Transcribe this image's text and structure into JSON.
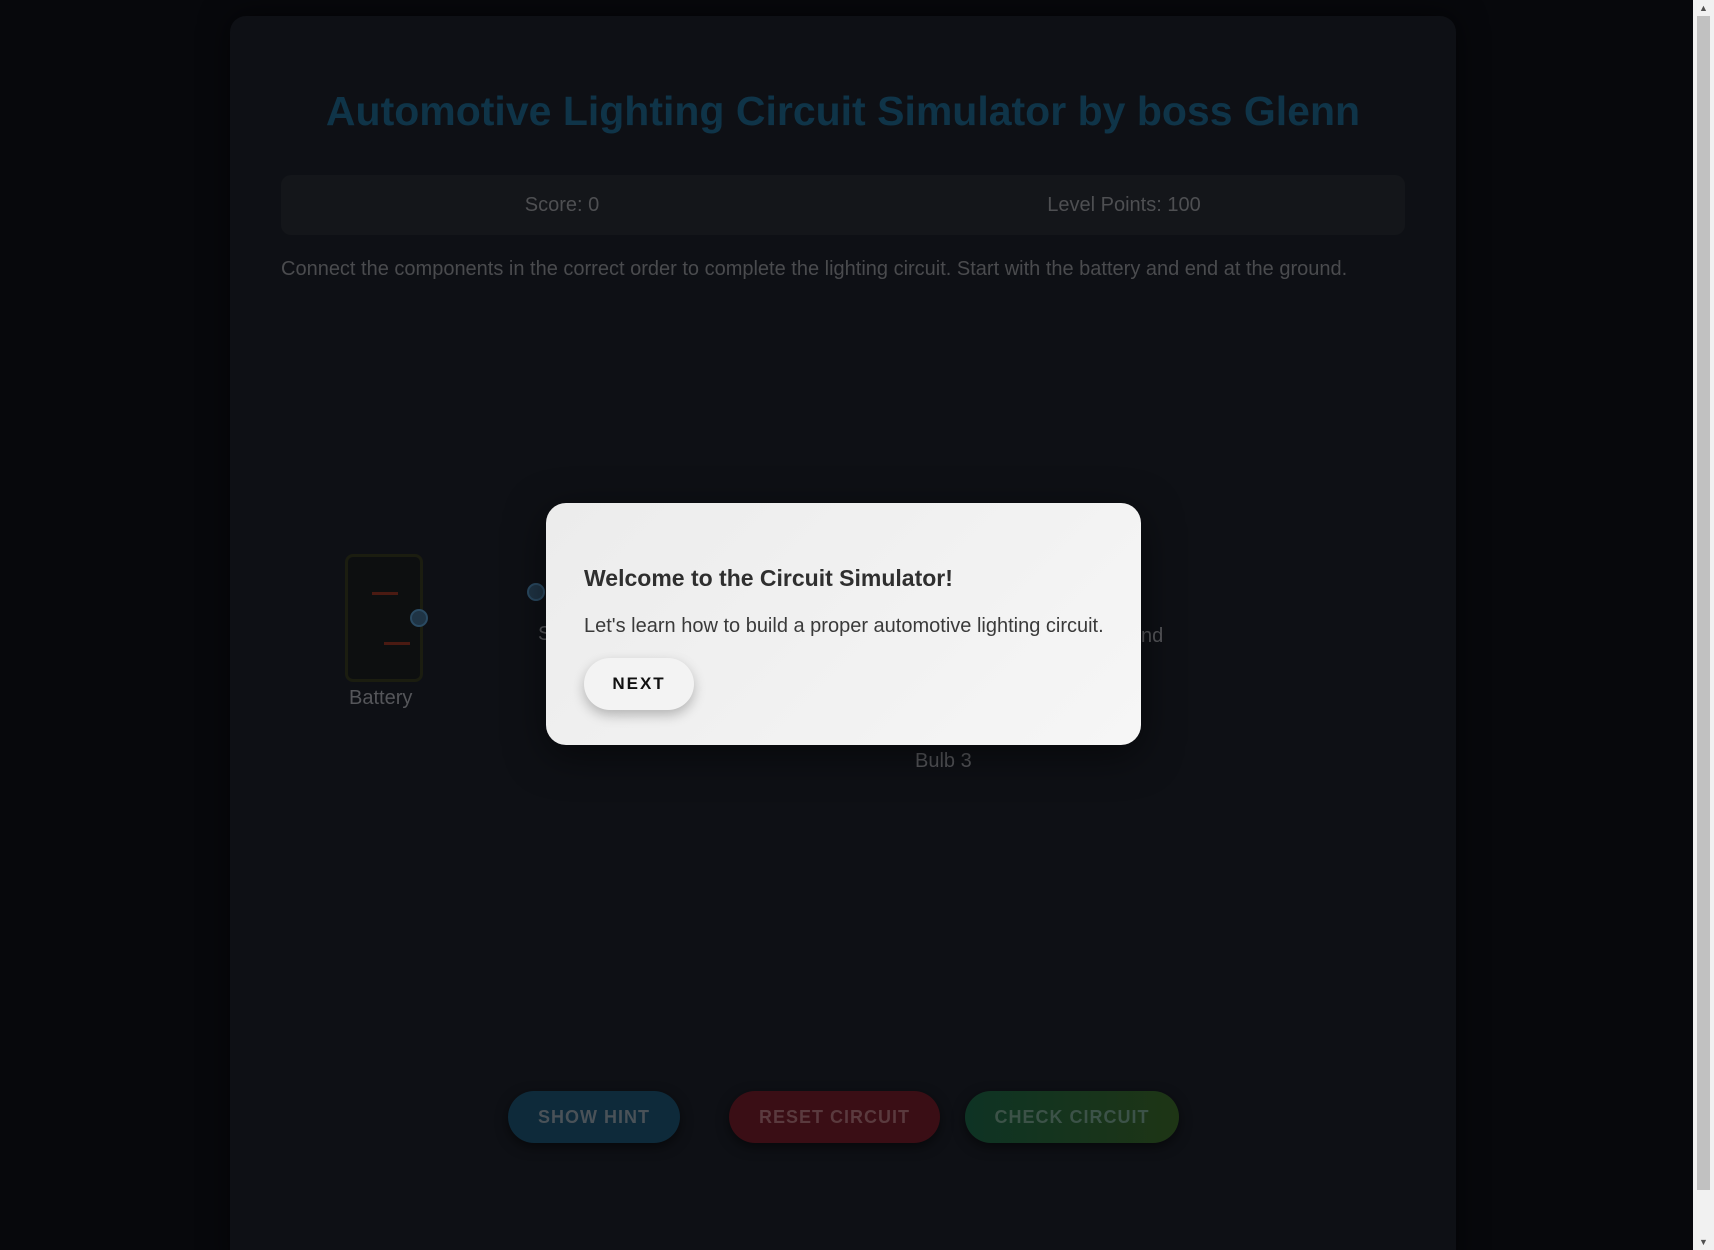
{
  "app": {
    "title": "Automotive Lighting Circuit Simulator by boss Glenn",
    "score_label": "Score: 0",
    "level_points_label": "Level Points: 100",
    "instructions": "Connect the components in the correct order to complete the lighting circuit. Start with the battery and end at the ground."
  },
  "components": {
    "battery_label": "Battery",
    "bulb3_label": "Bulb 3",
    "ground_label_partial": "nd",
    "switch_label_partial": "S"
  },
  "buttons": {
    "hint": "SHOW HINT",
    "reset": "RESET CIRCUIT",
    "check": "CHECK CIRCUIT"
  },
  "modal": {
    "title": "Welcome to the Circuit Simulator!",
    "text": "Let's learn how to build a proper automotive lighting circuit.",
    "next_label": "NEXT"
  },
  "scrollbar": {
    "up_arrow": "▲",
    "down_arrow": "▼"
  },
  "colors": {
    "title": "#0f3448",
    "modal_bg": "#f3f3f3",
    "hint_button": "#0e2a3a",
    "reset_button": "#3a0e15",
    "check_button": "#0e3324"
  }
}
